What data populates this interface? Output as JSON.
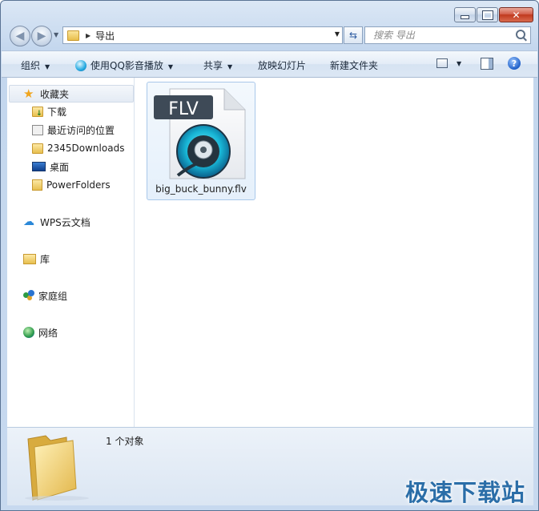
{
  "window": {
    "caption": {
      "minimize_icon": "minimize-icon",
      "maximize_icon": "maximize-icon",
      "close_glyph": "✕"
    }
  },
  "navigation": {
    "back_glyph": "◀",
    "forward_glyph": "▶",
    "address": {
      "current_folder": "导出",
      "separator": "▶"
    },
    "refresh_glyph": "⇆",
    "search": {
      "placeholder": "搜索 导出"
    }
  },
  "toolbar": {
    "organize": "组织",
    "play_with_qq": "使用QQ影音播放",
    "share": "共享",
    "slideshow": "放映幻灯片",
    "new_folder": "新建文件夹",
    "help_glyph": "?",
    "caret": "▼"
  },
  "nav_pane": {
    "favorites": {
      "label": "收藏夹",
      "icon": "star-icon"
    },
    "favorites_items": [
      {
        "label": "下载",
        "icon": "download-folder-icon"
      },
      {
        "label": "最近访问的位置",
        "icon": "recent-places-icon"
      },
      {
        "label": "2345Downloads",
        "icon": "folder-icon"
      },
      {
        "label": "桌面",
        "icon": "desktop-icon"
      },
      {
        "label": "PowerFolders",
        "icon": "powerfolders-icon"
      }
    ],
    "wps_cloud": "WPS云文档",
    "libraries": "库",
    "homegroup": "家庭组",
    "network": "网络"
  },
  "content": {
    "files": [
      {
        "name": "big_buck_bunny.flv",
        "type_badge": "FLV",
        "icon": "flv-file-icon"
      }
    ]
  },
  "details": {
    "count": "1 个对象",
    "watermark": "极速下载站"
  },
  "colors": {
    "chrome": "#c4d7ee",
    "selection": "#e5f0fb",
    "accent": "#2b6ea8"
  }
}
